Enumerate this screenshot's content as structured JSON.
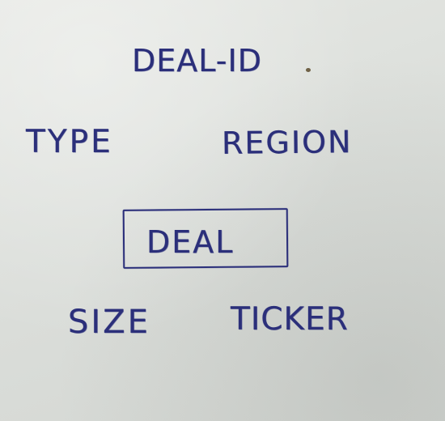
{
  "labels": {
    "deal_id": "DEAL-ID",
    "type": "TYPE",
    "region": "REGION",
    "deal": "DEAL",
    "size": "SIZE",
    "ticker": "TICKER"
  },
  "ink_color": "#2b2f7a",
  "paper_color": "#dcdfdb"
}
